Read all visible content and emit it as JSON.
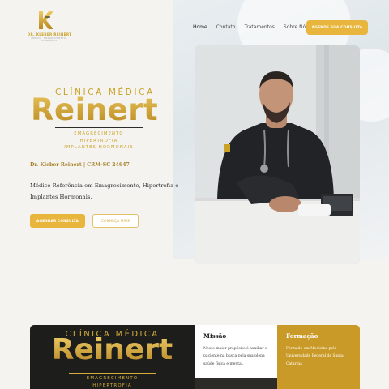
{
  "logo": {
    "name": "DR. KLEBER REINERT",
    "subtitle": "MÉDICO · EMAGRECIMENTO · HORMÔNIOS"
  },
  "nav": {
    "items": [
      "Home",
      "Contato",
      "Tratamentos",
      "Sobre Nós"
    ],
    "cta": "AGENDE SUA CONSULTA"
  },
  "hero": {
    "brand_small": "CLÍNICA MÉDICA",
    "brand_big": "Reinert",
    "tags": [
      "EMAGRECIMENTO",
      "HIPERTROFIA",
      "IMPLANTES HORMONAIS"
    ],
    "doctor": "Dr. Kleber Reinert | CRM-SC 24647",
    "description": "Médico Referência em Emagrecimento, Hipertrofia e Implantes Hormonais.",
    "primary_button": "AGENDAR CONSULTA",
    "secondary_button": "CONHEÇA MAIS"
  },
  "about": {
    "brand_small": "CLÍNICA MÉDICA",
    "brand_big": "Reinert",
    "tags": [
      "EMAGRECIMENTO",
      "HIPERTROFIA"
    ],
    "mission_title": "Missão",
    "mission_text": "Nosso maior propósito é auxiliar o paciente na busca pela sua plena saúde física e mental.",
    "training_title": "Formação",
    "training_text": "Formado em Medicina pela Universidade Federal de Santa Catarina"
  },
  "colors": {
    "accent": "#e8b63c",
    "gold": "#c99a27",
    "dark": "#1d1d1b",
    "background": "#f4f3f0"
  }
}
